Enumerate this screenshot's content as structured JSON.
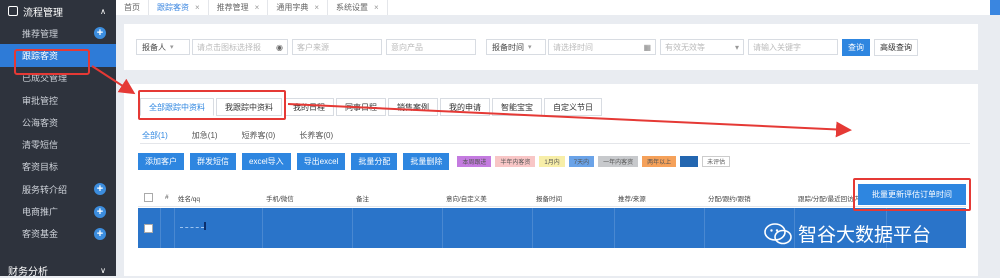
{
  "sidebar": {
    "header": "流程管理",
    "items": [
      {
        "label": "推荐管理",
        "plus": true
      },
      {
        "label": "跟踪客资",
        "active": true
      },
      {
        "label": "已成交管理"
      },
      {
        "label": "审批管控"
      },
      {
        "label": "公海客资"
      },
      {
        "label": "清零短信"
      },
      {
        "label": "客资目标"
      },
      {
        "label": "服务转介绍",
        "plus": true
      },
      {
        "label": "电商推广",
        "plus": true
      },
      {
        "label": "客资基金",
        "plus": true
      }
    ],
    "footer": "财务分析"
  },
  "tabs": [
    {
      "label": "首页",
      "close": false
    },
    {
      "label": "跟踪客资",
      "close": true,
      "active": true
    },
    {
      "label": "推荐管理",
      "close": true
    },
    {
      "label": "通用字典",
      "close": true
    },
    {
      "label": "系统设置",
      "close": true
    }
  ],
  "search": {
    "reporter": "报备人",
    "reporter_placeholder": "请点击图标选择报",
    "source_placeholder": "客户来源",
    "product_placeholder": "意向产品",
    "time_label": "报备时间",
    "time_placeholder": "请选择时间",
    "valid_placeholder": "有效无效等",
    "keyword_placeholder": "请输入关键字",
    "query": "查询",
    "advanced": "高级查询"
  },
  "main_tabs": [
    "全部跟踪中资料",
    "我跟踪中资料",
    "我的日程",
    "同事日程",
    "销售案例",
    "我的申请",
    "智能宝宝",
    "自定义节日"
  ],
  "sub_tabs": [
    "全部(1)",
    "加急(1)",
    "短养客(0)",
    "长养客(0)"
  ],
  "actions": [
    "添加客户",
    "群发短信",
    "excel导入",
    "导出excel",
    "批量分配",
    "批量删除"
  ],
  "chips": [
    {
      "label": "本周跟进",
      "bg": "#c47be0"
    },
    {
      "label": "半年内客资",
      "bg": "#f8c6c6"
    },
    {
      "label": "1月内",
      "bg": "#f7eea8"
    },
    {
      "label": "7天内",
      "bg": "#6aa3e8"
    },
    {
      "label": "一年内客资",
      "bg": "#c7c9cc"
    },
    {
      "label": "两年以上",
      "bg": "#f5a15a"
    },
    {
      "label": "",
      "bg": "#2366b0"
    },
    {
      "label": "未评估",
      "bg": "#ffffff"
    }
  ],
  "batch_button": "批量更新评估订单时间",
  "table_headers": [
    "#",
    "姓名/qq",
    "手机/微信",
    "备注",
    "意向/自定义美",
    "报备时间",
    "推荐/来源",
    "分配/跟约/跟销",
    "跟踪/分配/最近回访内容",
    "操作"
  ],
  "watermark": "智谷大数据平台",
  "colors": {
    "accent": "#2e86e0",
    "sidebar": "#2e333d",
    "highlight": "#e53935"
  }
}
